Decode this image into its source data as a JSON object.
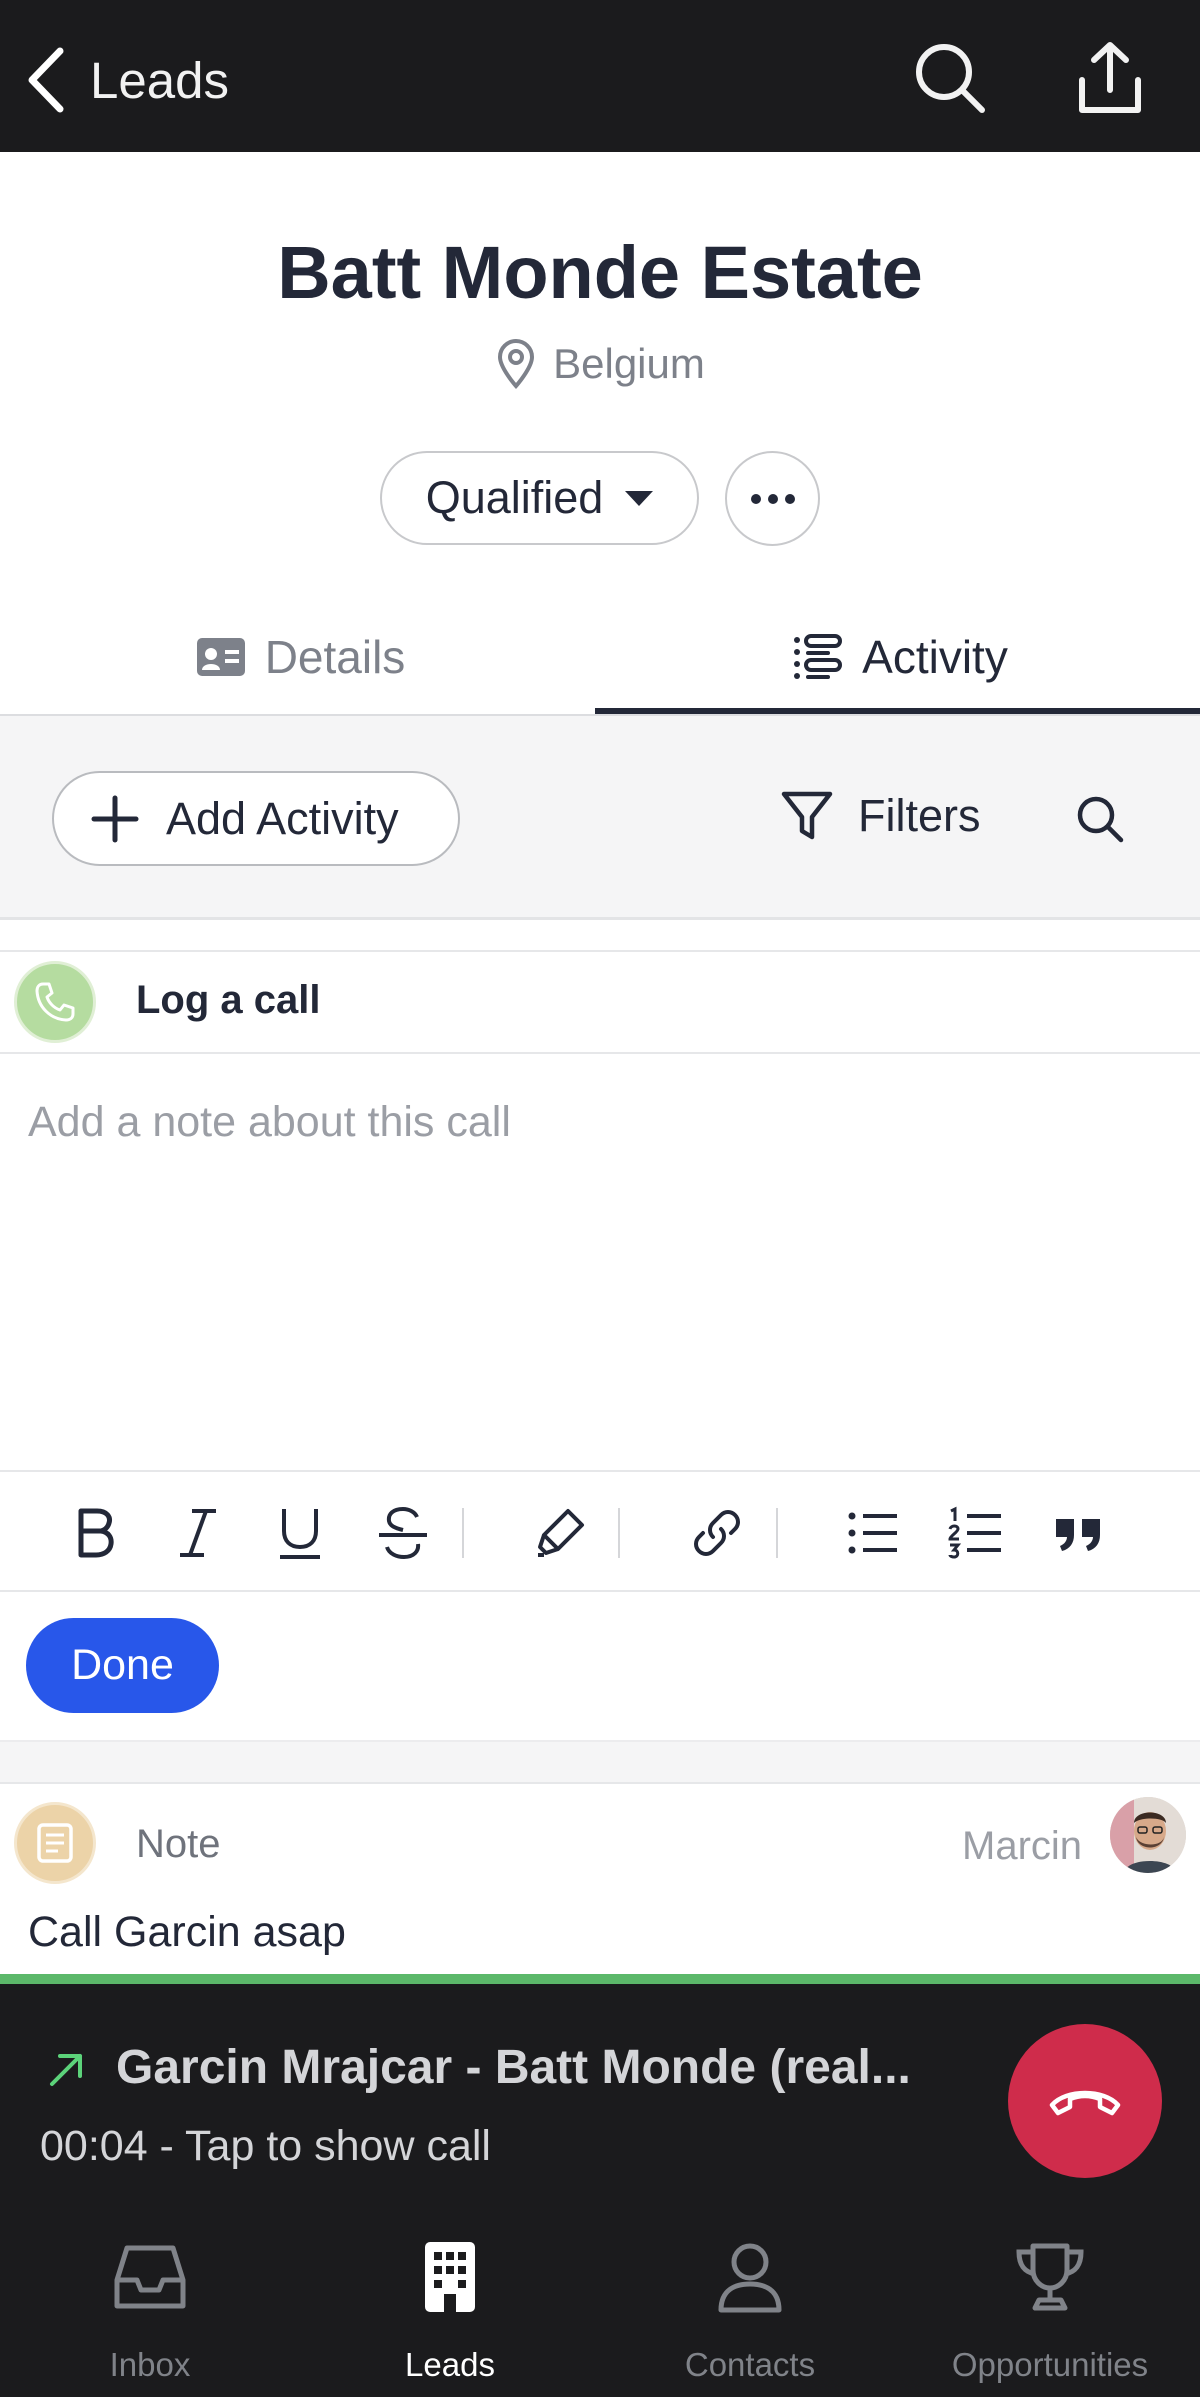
{
  "header": {
    "back_label": "Leads",
    "icons": [
      "chevron-left-icon",
      "search-icon",
      "share-icon"
    ]
  },
  "lead": {
    "name": "Batt Monde Estate",
    "location": "Belgium",
    "status": "Qualified"
  },
  "tabs": [
    {
      "label": "Details",
      "icon": "contact-card-icon",
      "active": false
    },
    {
      "label": "Activity",
      "icon": "activity-list-icon",
      "active": true
    }
  ],
  "activity_toolbar": {
    "add_label": "Add Activity",
    "filters_label": "Filters"
  },
  "log_call": {
    "title": "Log a call",
    "note_placeholder": "Add a note about this call",
    "format_tools": [
      "bold",
      "italic",
      "underline",
      "strikethrough",
      "highlight",
      "link",
      "bulleted-list",
      "numbered-list",
      "quote"
    ],
    "done_label": "Done"
  },
  "note": {
    "type_label": "Note",
    "author": "Marcin",
    "text": "Call Garcin asap"
  },
  "active_call": {
    "title": "Garcin Mrajcar - Batt Monde (real...",
    "subtitle": "00:04 - Tap to show call",
    "indicator_color": "#5cb86a",
    "hangup_color": "#cf2c4b"
  },
  "bottom_nav": [
    {
      "label": "Inbox",
      "icon": "inbox-icon",
      "active": false
    },
    {
      "label": "Leads",
      "icon": "building-icon",
      "active": true
    },
    {
      "label": "Contacts",
      "icon": "person-icon",
      "active": false
    },
    {
      "label": "Opportunities",
      "icon": "trophy-icon",
      "active": false
    }
  ],
  "colors": {
    "primary": "#2857ea",
    "topbar": "#1b1b1d",
    "text": "#232838"
  }
}
